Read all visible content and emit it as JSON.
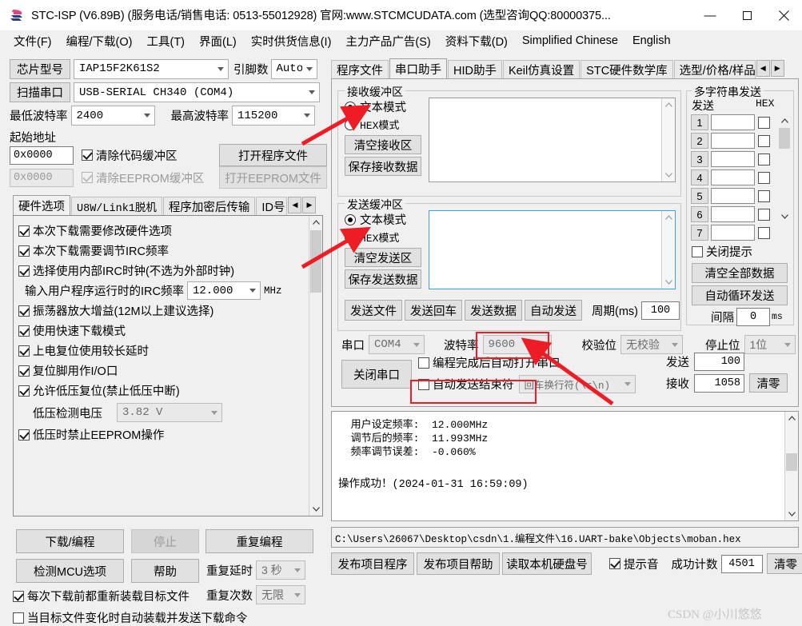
{
  "titlebar": {
    "title": "STC-ISP (V6.89B) (服务电话/销售电话: 0513-55012928) 官网:www.STCMCUDATA.com (选型咨询QQ:80000375...",
    "minimize": "—",
    "maximize": "❐",
    "close": "✕"
  },
  "menubar": {
    "items": [
      {
        "label": "文件(F)"
      },
      {
        "label": "编程/下载(O)"
      },
      {
        "label": "工具(T)"
      },
      {
        "label": "界面(L)"
      },
      {
        "label": "实时供货信息(I)"
      },
      {
        "label": "主力产品广告(S)"
      },
      {
        "label": "资料下载(D)"
      },
      {
        "label": "Simplified Chinese"
      },
      {
        "label": "English"
      }
    ]
  },
  "left": {
    "chip_button": "芯片型号",
    "chip_value": "IAP15F2K61S2",
    "pin_label": "引脚数",
    "pin_value": "Auto",
    "scan_button": "扫描串口",
    "port_value": "USB-SERIAL CH340 (COM4)",
    "min_baud_label": "最低波特率",
    "min_baud_value": "2400",
    "max_baud_label": "最高波特率",
    "max_baud_value": "115200",
    "start_addr_label": "起始地址",
    "code_addr_value": "0x0000",
    "eeprom_addr_value": "0x0000",
    "clear_code_buffer": "清除代码缓冲区",
    "clear_eeprom_buffer": "清除EEPROM缓冲区",
    "open_program_file": "打开程序文件",
    "open_eeprom_file": "打开EEPROM文件",
    "tabs": [
      {
        "label": "硬件选项",
        "active": true
      },
      {
        "label": "U8W/Link1脱机",
        "active": false
      },
      {
        "label": "程序加密后传输",
        "active": false
      },
      {
        "label": "ID号",
        "active": false
      }
    ],
    "tab_scroll_left": "◀",
    "tab_scroll_right": "▶",
    "options": [
      {
        "label": "本次下载需要修改硬件选项",
        "checked": true,
        "type": "check"
      },
      {
        "label": "本次下载需要调节IRC频率",
        "checked": true,
        "type": "check"
      },
      {
        "label": "选择使用内部IRC时钟(不选为外部时钟)",
        "checked": true,
        "type": "check"
      },
      {
        "label": "输入用户程序运行时的IRC频率",
        "type": "combo",
        "value": "12.000",
        "unit": "MHz"
      },
      {
        "label": "振荡器放大增益(12M以上建议选择)",
        "checked": true,
        "type": "check"
      },
      {
        "label": "使用快速下载模式",
        "checked": true,
        "type": "check"
      },
      {
        "label": "上电复位使用较长延时",
        "checked": true,
        "type": "check"
      },
      {
        "label": "复位脚用作I/O口",
        "checked": true,
        "type": "check"
      },
      {
        "label": "允许低压复位(禁止低压中断)",
        "checked": true,
        "type": "check"
      },
      {
        "label": "低压检测电压",
        "type": "combo",
        "value": "3.82 V",
        "unit": ""
      },
      {
        "label": "低压时禁止EEPROM操作",
        "checked": true,
        "type": "check"
      }
    ],
    "download_button": "下载/编程",
    "stop_button": "停止",
    "repeat_button": "重复编程",
    "detect_mcu_button": "检测MCU选项",
    "help_button": "帮助",
    "repeat_delay_label": "重复延时",
    "repeat_delay_value": "3 秒",
    "repeat_count_label": "重复次数",
    "repeat_count_value": "无限",
    "reload_checkbox": "每次下载前都重新装载目标文件",
    "reload_checked": true,
    "autoload_checkbox": "当目标文件变化时自动装载并发送下载命令",
    "autoload_checked": false
  },
  "right": {
    "tabs": [
      {
        "label": "程序文件",
        "active": false
      },
      {
        "label": "串口助手",
        "active": true
      },
      {
        "label": "HID助手",
        "active": false
      },
      {
        "label": "Keil仿真设置",
        "active": false
      },
      {
        "label": "STC硬件数学库",
        "active": false
      },
      {
        "label": "选型/价格/样品",
        "active": false
      }
    ],
    "tab_scroll_left": "◀",
    "tab_scroll_right": "▶",
    "receive": {
      "title": "接收缓冲区",
      "text_mode": "文本模式",
      "hex_mode": "HEX模式",
      "mode_selected": "text",
      "clear_button": "清空接收区",
      "save_button": "保存接收数据",
      "content": ""
    },
    "send": {
      "title": "发送缓冲区",
      "text_mode": "文本模式",
      "hex_mode": "HEX模式",
      "mode_selected": "text",
      "clear_button": "清空发送区",
      "save_button": "保存发送数据",
      "content": "",
      "send_file": "发送文件",
      "send_return": "发送回车",
      "send_data": "发送数据",
      "auto_send": "自动发送",
      "period_label": "周期(ms)",
      "period_value": "100"
    },
    "serial": {
      "port_label": "串口",
      "port_value": "COM4",
      "baud_label": "波特率",
      "baud_value": "9600",
      "parity_label": "校验位",
      "parity_value": "无校验",
      "stop_label": "停止位",
      "stop_value": "1位",
      "close_port_button": "关闭串口",
      "auto_open_checkbox": "编程完成后自动打开串口",
      "auto_open_checked": false,
      "auto_terminator_checkbox": "自动发送结束符",
      "auto_terminator_checked": false,
      "terminator_value": "回车换行符(\\r\\n)",
      "tx_label": "发送",
      "tx_value": "100",
      "rx_label": "接收",
      "rx_value": "1058",
      "reset_button": "清零"
    },
    "multistring": {
      "title": "多字符串发送",
      "send_col": "发送",
      "hex_col": "HEX",
      "rows": [
        {
          "index": "1",
          "value": "",
          "hex": false
        },
        {
          "index": "2",
          "value": "",
          "hex": false
        },
        {
          "index": "3",
          "value": "",
          "hex": false
        },
        {
          "index": "4",
          "value": "",
          "hex": false
        },
        {
          "index": "5",
          "value": "",
          "hex": false
        },
        {
          "index": "6",
          "value": "",
          "hex": false
        },
        {
          "index": "7",
          "value": "",
          "hex": false
        }
      ],
      "close_tip_checkbox": "关闭提示",
      "close_tip_checked": false,
      "clear_all_button": "清空全部数据",
      "auto_loop_button": "自动循环发送",
      "interval_label": "间隔",
      "interval_value": "0",
      "interval_unit": "ms"
    },
    "log": {
      "lines": [
        "  用户设定频率:  12.000MHz",
        "  调节后的频率:  11.993MHz",
        "  频率调节误差:  -0.060%",
        "",
        "操作成功！(2024-01-31 16:59:09)"
      ]
    },
    "filepath": "C:\\Users\\26067\\Desktop\\csdn\\1.编程文件\\16.UART-bake\\Objects\\moban.hex",
    "bottom": {
      "publish_program": "发布项目程序",
      "publish_help": "发布项目帮助",
      "read_disk_id": "读取本机硬盘号",
      "beep_checkbox": "提示音",
      "beep_checked": true,
      "success_count_label": "成功计数",
      "success_count_value": "4501",
      "reset_button": "清零"
    },
    "watermark": "CSDN @小川悠悠"
  },
  "annotations": {
    "accent_color": "#ee1c25",
    "highlight_baud": "9600",
    "highlight_terminator": "自动发送结束符"
  }
}
